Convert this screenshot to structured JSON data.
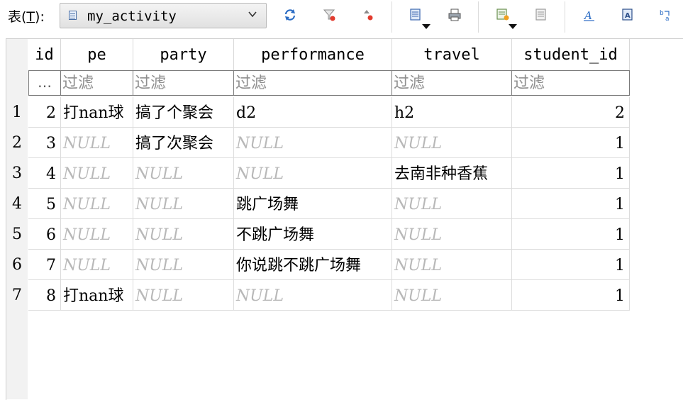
{
  "toolbar": {
    "table_label_prefix": "表(",
    "table_label_mnemonic": "T",
    "table_label_suffix": "):",
    "selected_table": "my_activity",
    "buttons": [
      {
        "icon": "refresh-icon"
      },
      {
        "icon": "filter-icon"
      },
      {
        "icon": "sort-icon"
      },
      {
        "icon": "export-icon"
      },
      {
        "icon": "print-icon"
      },
      {
        "icon": "add-row-icon"
      },
      {
        "icon": "delete-row-icon"
      },
      {
        "icon": "font-icon"
      },
      {
        "icon": "text-icon"
      },
      {
        "icon": "wrap-icon"
      }
    ]
  },
  "grid": {
    "columns": [
      "id",
      "pe",
      "party",
      "performance",
      "travel",
      "student_id"
    ],
    "filter_placeholder": "过滤",
    "row_selector_label": "…",
    "null_text": "NULL",
    "row_numbers": [
      "1",
      "2",
      "3",
      "4",
      "5",
      "6",
      "7"
    ],
    "rows": [
      [
        "2",
        "打nan球",
        "搞了个聚会",
        "d2",
        "h2",
        "2"
      ],
      [
        "3",
        null,
        "搞了次聚会",
        null,
        null,
        "1"
      ],
      [
        "4",
        null,
        null,
        null,
        "去南非种香蕉",
        "1"
      ],
      [
        "5",
        null,
        null,
        "跳广场舞",
        null,
        "1"
      ],
      [
        "6",
        null,
        null,
        "不跳广场舞",
        null,
        "1"
      ],
      [
        "7",
        null,
        null,
        "你说跳不跳广场舞",
        null,
        "1"
      ],
      [
        "8",
        "打nan球",
        null,
        null,
        null,
        "1"
      ]
    ]
  },
  "colors": {
    "null_text": "#b8b8b8",
    "gutter_bg": "#f2f2f2",
    "grid_line": "#dcdcdc"
  }
}
